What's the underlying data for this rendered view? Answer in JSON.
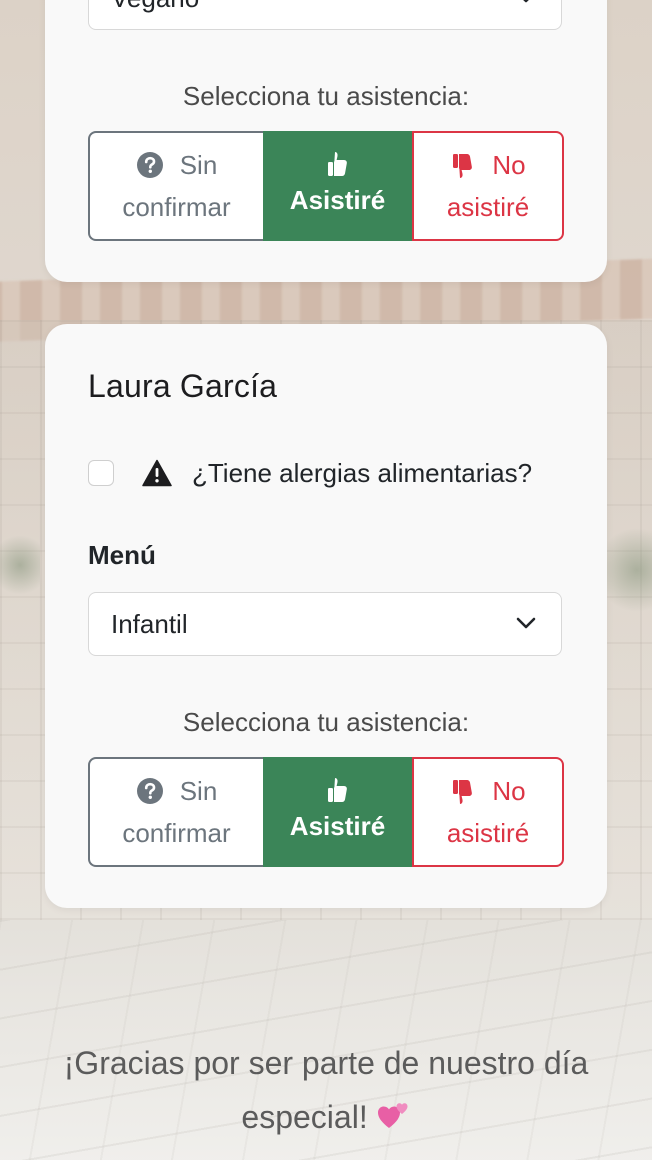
{
  "guests": [
    {
      "name": "",
      "menu_value": "Vegano",
      "assist_prompt": "Selecciona tu asistencia:",
      "options": {
        "sin_line1": "Sin",
        "sin_line2": "confirmar",
        "asistire": "Asistiré",
        "no_line1": "No",
        "no_line2": "asistiré"
      },
      "selected": "asistire"
    },
    {
      "name": "Laura García",
      "allergy_question": "¿Tiene alergias alimentarias?",
      "allergy_checked": false,
      "menu_label": "Menú",
      "menu_value": "Infantil",
      "assist_prompt": "Selecciona tu asistencia:",
      "options": {
        "sin_line1": "Sin",
        "sin_line2": "confirmar",
        "asistire": "Asistiré",
        "no_line1": "No",
        "no_line2": "asistiré"
      },
      "selected": "asistire"
    }
  ],
  "footer": {
    "line1": "¡Gracias por ser parte de nuestro día",
    "line2": "especial!"
  },
  "icons": {
    "question": "question-circle-icon",
    "thumbs_up": "thumbs-up-icon",
    "thumbs_down": "thumbs-down-icon",
    "warning": "warning-triangle-icon",
    "chevron": "chevron-down-icon",
    "heart": "two-hearts-icon"
  },
  "colors": {
    "success": "#3b8558",
    "danger": "#dc3545",
    "secondary": "#6c757d"
  }
}
